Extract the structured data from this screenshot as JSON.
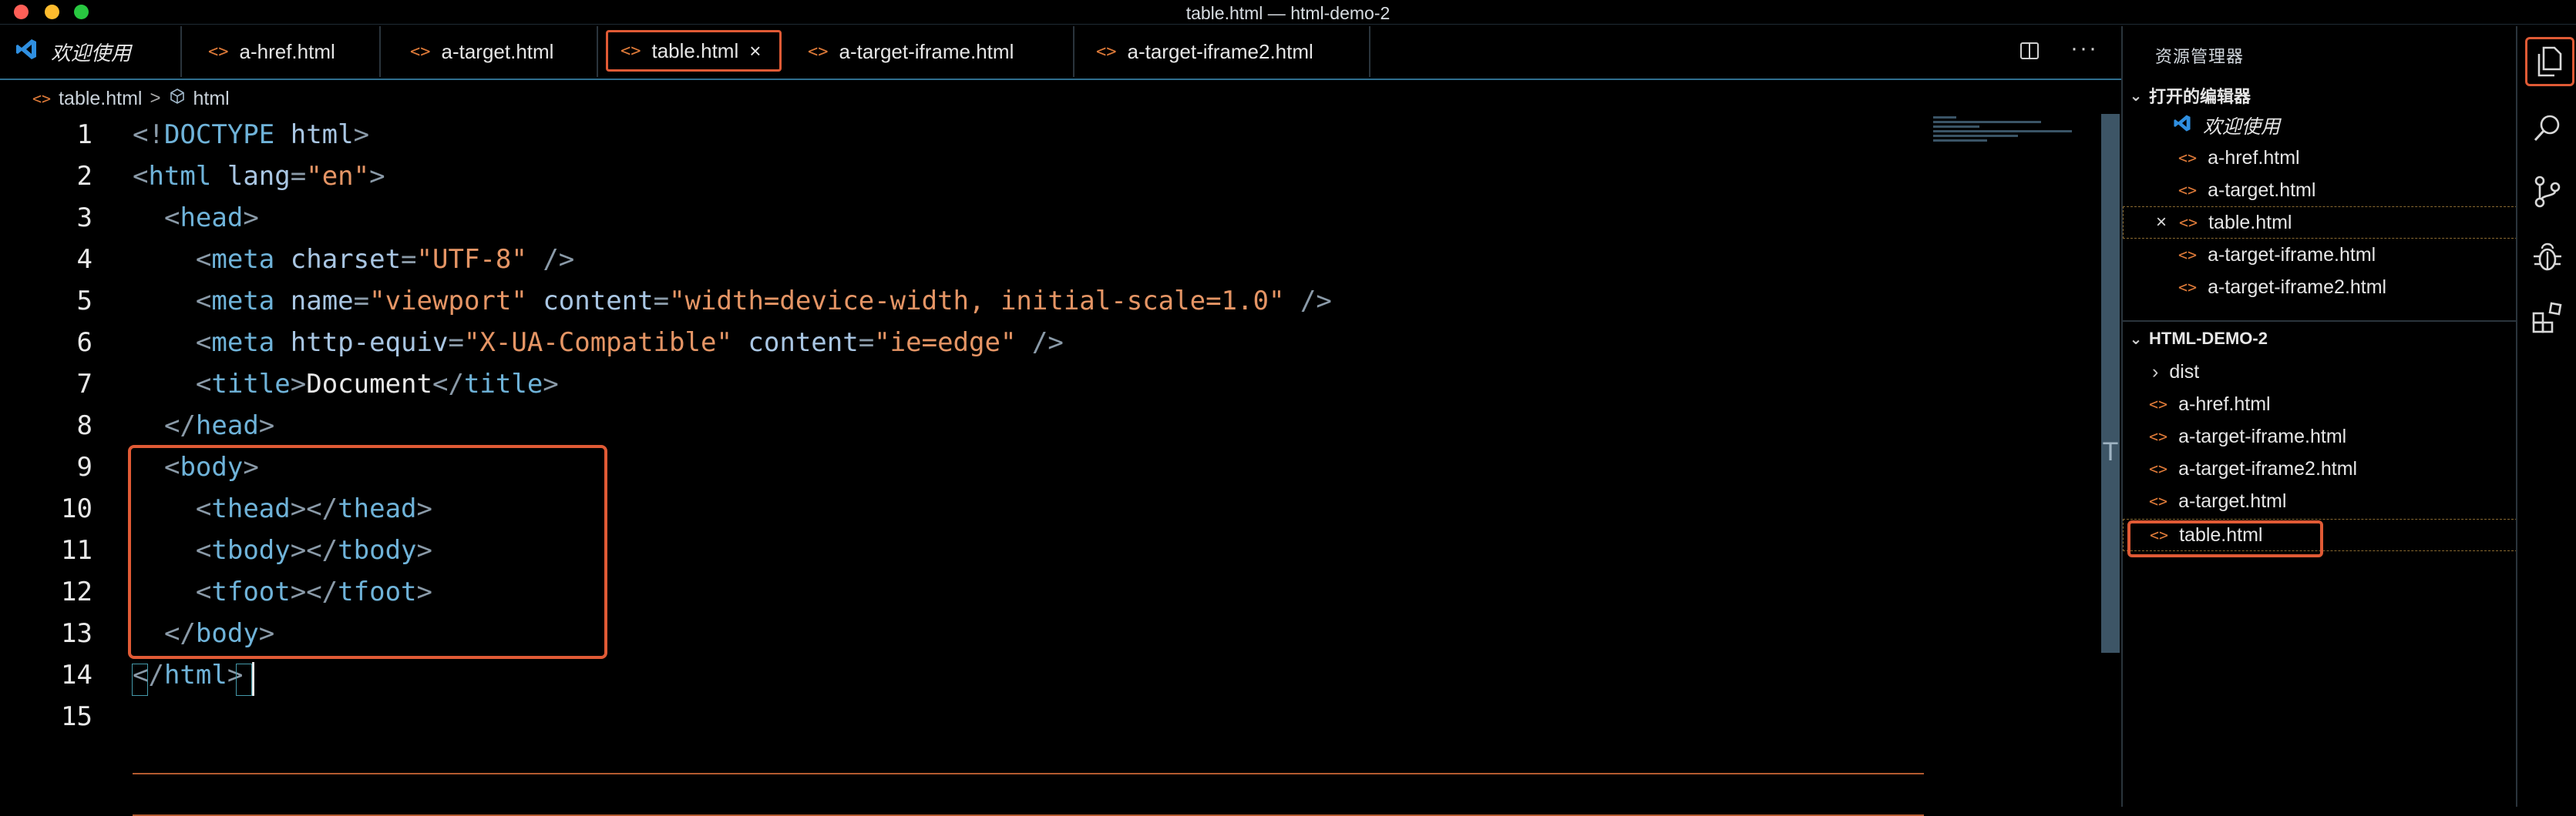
{
  "window": {
    "title": "table.html — html-demo-2"
  },
  "tabs": [
    {
      "label": "欢迎使用",
      "kind": "welcome"
    },
    {
      "label": "a-href.html",
      "kind": "html"
    },
    {
      "label": "a-target.html",
      "kind": "html"
    },
    {
      "label": "table.html",
      "kind": "html",
      "active": true,
      "close": "×"
    },
    {
      "label": "a-target-iframe.html",
      "kind": "html"
    },
    {
      "label": "a-target-iframe2.html",
      "kind": "html"
    }
  ],
  "breadcrumb": {
    "file": "table.html",
    "separator": ">",
    "symbol": "html"
  },
  "editor": {
    "line_numbers": [
      "1",
      "2",
      "3",
      "4",
      "5",
      "6",
      "7",
      "8",
      "9",
      "10",
      "11",
      "12",
      "13",
      "14",
      "15"
    ],
    "lines": [
      {
        "indent": "",
        "tokens": [
          [
            "punc",
            "<!"
          ],
          [
            "tag",
            "DOCTYPE"
          ],
          [
            "txt",
            " "
          ],
          [
            "attr",
            "html"
          ],
          [
            "punc",
            ">"
          ]
        ]
      },
      {
        "indent": "",
        "tokens": [
          [
            "punc",
            "<"
          ],
          [
            "tag",
            "html"
          ],
          [
            "txt",
            " "
          ],
          [
            "attr",
            "lang"
          ],
          [
            "punc",
            "="
          ],
          [
            "str",
            "\"en\""
          ],
          [
            "punc",
            ">"
          ]
        ]
      },
      {
        "indent": "  ",
        "tokens": [
          [
            "punc",
            "<"
          ],
          [
            "tag",
            "head"
          ],
          [
            "punc",
            ">"
          ]
        ]
      },
      {
        "indent": "    ",
        "tokens": [
          [
            "punc",
            "<"
          ],
          [
            "tag",
            "meta"
          ],
          [
            "txt",
            " "
          ],
          [
            "attr",
            "charset"
          ],
          [
            "punc",
            "="
          ],
          [
            "str",
            "\"UTF-8\""
          ],
          [
            "txt",
            " "
          ],
          [
            "punc",
            "/>"
          ]
        ]
      },
      {
        "indent": "    ",
        "tokens": [
          [
            "punc",
            "<"
          ],
          [
            "tag",
            "meta"
          ],
          [
            "txt",
            " "
          ],
          [
            "attr",
            "name"
          ],
          [
            "punc",
            "="
          ],
          [
            "str",
            "\"viewport\""
          ],
          [
            "txt",
            " "
          ],
          [
            "attr",
            "content"
          ],
          [
            "punc",
            "="
          ],
          [
            "str",
            "\"width=device-width, initial-scale=1.0\""
          ],
          [
            "txt",
            " "
          ],
          [
            "punc",
            "/>"
          ]
        ]
      },
      {
        "indent": "    ",
        "tokens": [
          [
            "punc",
            "<"
          ],
          [
            "tag",
            "meta"
          ],
          [
            "txt",
            " "
          ],
          [
            "attr",
            "http-equiv"
          ],
          [
            "punc",
            "="
          ],
          [
            "str",
            "\"X-UA-Compatible\""
          ],
          [
            "txt",
            " "
          ],
          [
            "attr",
            "content"
          ],
          [
            "punc",
            "="
          ],
          [
            "str",
            "\"ie=edge\""
          ],
          [
            "txt",
            " "
          ],
          [
            "punc",
            "/>"
          ]
        ]
      },
      {
        "indent": "    ",
        "tokens": [
          [
            "punc",
            "<"
          ],
          [
            "tag",
            "title"
          ],
          [
            "punc",
            ">"
          ],
          [
            "txt",
            "Document"
          ],
          [
            "punc",
            "</"
          ],
          [
            "tag",
            "title"
          ],
          [
            "punc",
            ">"
          ]
        ]
      },
      {
        "indent": "  ",
        "tokens": [
          [
            "punc",
            "</"
          ],
          [
            "tag",
            "head"
          ],
          [
            "punc",
            ">"
          ]
        ]
      },
      {
        "indent": "  ",
        "tokens": [
          [
            "punc",
            "<"
          ],
          [
            "tag",
            "body"
          ],
          [
            "punc",
            ">"
          ]
        ]
      },
      {
        "indent": "    ",
        "tokens": [
          [
            "punc",
            "<"
          ],
          [
            "tag",
            "thead"
          ],
          [
            "punc",
            "></"
          ],
          [
            "tag",
            "thead"
          ],
          [
            "punc",
            ">"
          ]
        ]
      },
      {
        "indent": "    ",
        "tokens": [
          [
            "punc",
            "<"
          ],
          [
            "tag",
            "tbody"
          ],
          [
            "punc",
            "></"
          ],
          [
            "tag",
            "tbody"
          ],
          [
            "punc",
            ">"
          ]
        ]
      },
      {
        "indent": "    ",
        "tokens": [
          [
            "punc",
            "<"
          ],
          [
            "tag",
            "tfoot"
          ],
          [
            "punc",
            "></"
          ],
          [
            "tag",
            "tfoot"
          ],
          [
            "punc",
            ">"
          ]
        ]
      },
      {
        "indent": "  ",
        "tokens": [
          [
            "punc",
            "</"
          ],
          [
            "tag",
            "body"
          ],
          [
            "punc",
            ">"
          ]
        ]
      },
      {
        "indent": "",
        "tokens": [
          [
            "punc",
            "</"
          ],
          [
            "tag",
            "html"
          ],
          [
            "punc",
            ">"
          ]
        ]
      },
      {
        "indent": "",
        "tokens": []
      }
    ],
    "scroll_marker": "T"
  },
  "explorer": {
    "title": "资源管理器",
    "open_editors": {
      "header": "打开的编辑器",
      "items": [
        {
          "label": "欢迎使用",
          "kind": "welcome"
        },
        {
          "label": "a-href.html",
          "kind": "html"
        },
        {
          "label": "a-target.html",
          "kind": "html"
        },
        {
          "label": "table.html",
          "kind": "html",
          "selected": true,
          "close": "×"
        },
        {
          "label": "a-target-iframe.html",
          "kind": "html"
        },
        {
          "label": "a-target-iframe2.html",
          "kind": "html"
        }
      ]
    },
    "workspace": {
      "header": "HTML-DEMO-2",
      "items": [
        {
          "label": "dist",
          "kind": "folder"
        },
        {
          "label": "a-href.html",
          "kind": "html"
        },
        {
          "label": "a-target-iframe.html",
          "kind": "html"
        },
        {
          "label": "a-target-iframe2.html",
          "kind": "html"
        },
        {
          "label": "a-target.html",
          "kind": "html"
        },
        {
          "label": "table.html",
          "kind": "html",
          "selected": true
        }
      ]
    }
  },
  "activity_bar": [
    {
      "icon": "files-icon",
      "active": true
    },
    {
      "icon": "search-icon"
    },
    {
      "icon": "source-control-icon"
    },
    {
      "icon": "debug-icon"
    },
    {
      "icon": "extensions-icon"
    }
  ],
  "colors": {
    "accent_highlight": "#e05a35",
    "tag": "#6fb3d9",
    "attribute": "#a9c6e3",
    "string": "#e59565",
    "file_icon": "#e07b39"
  }
}
